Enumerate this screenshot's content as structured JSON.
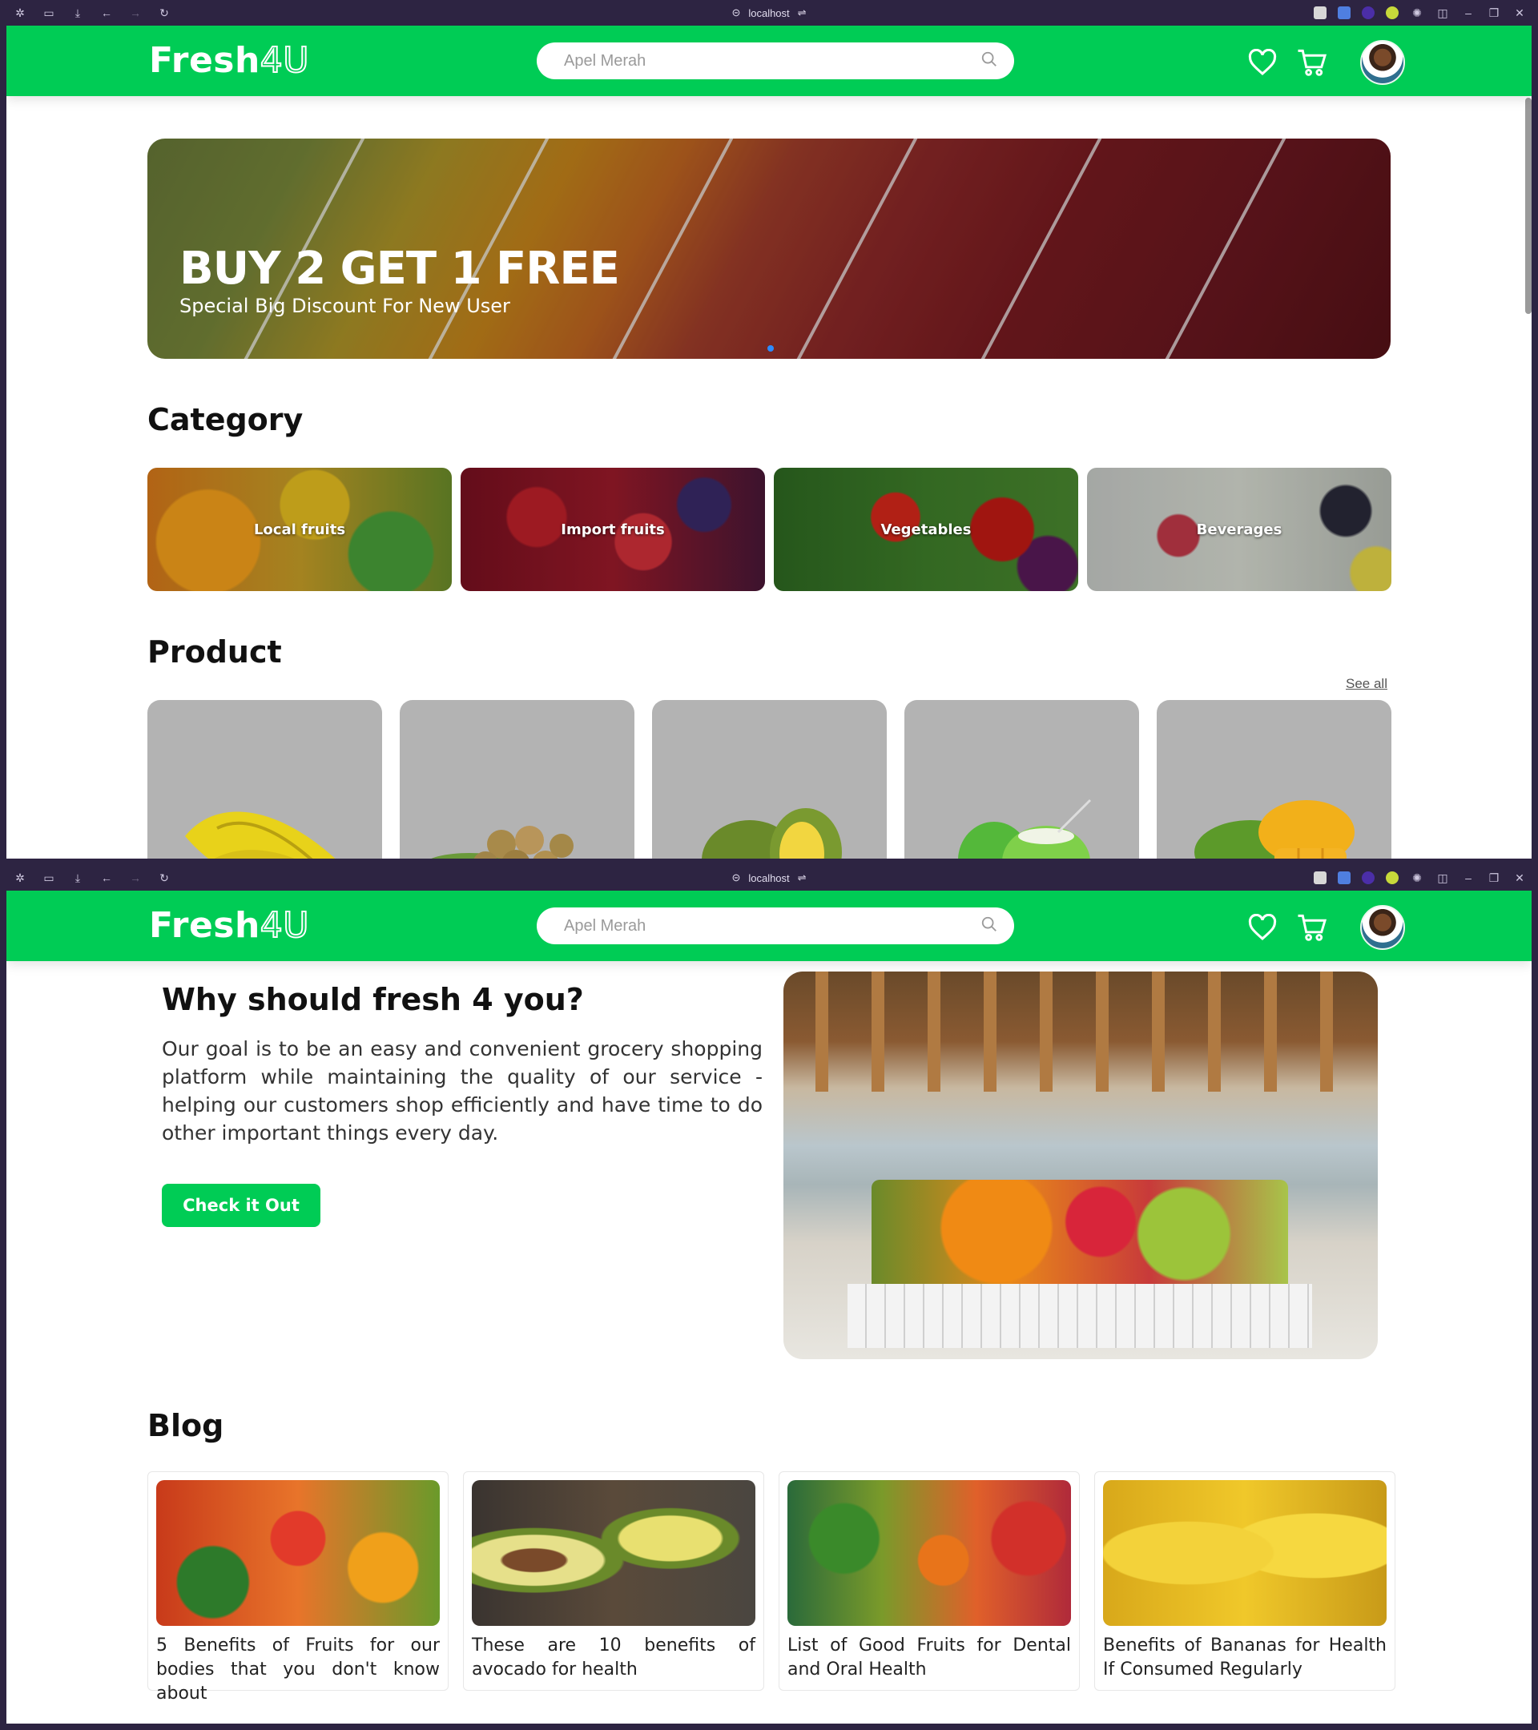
{
  "browser": {
    "url": "localhost"
  },
  "navbar": {
    "logo_main": "Fresh",
    "logo_accent": "4U",
    "search_placeholder": "Apel Merah"
  },
  "banner": {
    "headline": "BUY 2 GET 1 FREE",
    "subline": "Special Big Discount For New User"
  },
  "category": {
    "title": "Category",
    "items": [
      {
        "label": "Local fruits"
      },
      {
        "label": "Import fruits"
      },
      {
        "label": "Vegetables"
      },
      {
        "label": "Beverages"
      }
    ]
  },
  "product": {
    "title": "Product",
    "see_all": "See all",
    "items": [
      {
        "icon": "starfruit-icon"
      },
      {
        "icon": "longan-icon"
      },
      {
        "icon": "durian-icon"
      },
      {
        "icon": "coconut-icon"
      },
      {
        "icon": "mango-icon"
      }
    ]
  },
  "why": {
    "title": "Why should fresh 4 you?",
    "text": "Our goal is to be an easy and convenient grocery shopping platform while maintaining the quality of our service - helping our customers shop efficiently and have time to do other important things every day.",
    "cta": "Check it Out"
  },
  "blog": {
    "title": "Blog",
    "items": [
      {
        "title": "5 Benefits of Fruits for our bodies that you don't know about"
      },
      {
        "title": "These are 10 benefits of avocado for health"
      },
      {
        "title": "List of Good Fruits for Dental and Oral Health"
      },
      {
        "title": "Benefits of Bananas for Health If Consumed Regularly"
      }
    ]
  },
  "colors": {
    "brand": "#00cc55",
    "chrome": "#2d2442"
  }
}
